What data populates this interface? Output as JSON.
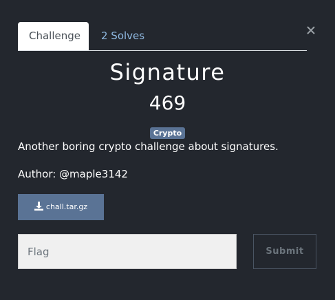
{
  "tabs": [
    {
      "label": "Challenge",
      "active": true
    },
    {
      "label": "2 Solves",
      "active": false
    }
  ],
  "challenge": {
    "name": "Signature",
    "points": "469",
    "tag": "Crypto",
    "description": "Another boring crypto challenge about signatures.",
    "author": "Author: @maple3142"
  },
  "file": {
    "label": "chall.tar.gz",
    "icon": "download-icon"
  },
  "flag_input": {
    "placeholder": "Flag",
    "value": ""
  },
  "submit": {
    "label": "Submit"
  },
  "colors": {
    "background": "#23272e",
    "accent": "#5a7395",
    "tab_link": "#8fb8e0"
  }
}
